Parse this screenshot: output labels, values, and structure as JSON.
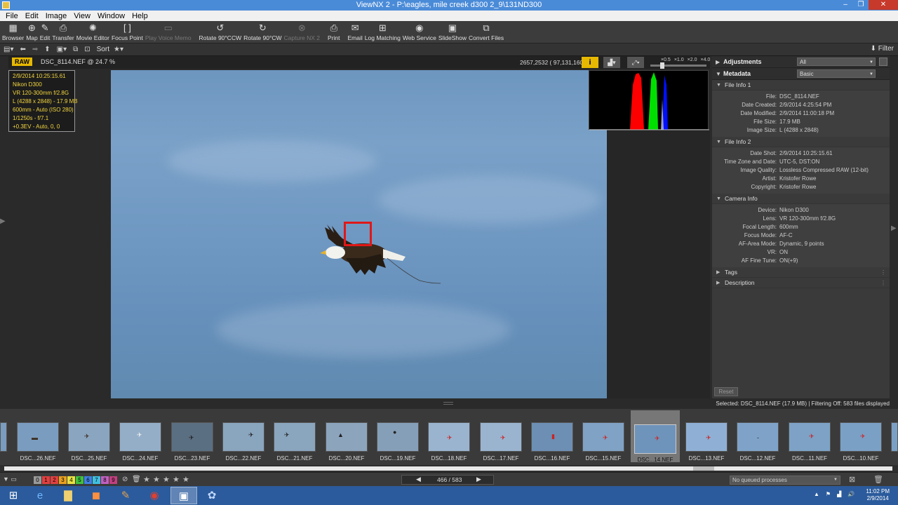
{
  "window": {
    "title": "ViewNX 2 - P:\\eagles, mile creek d300 2_9\\131ND300"
  },
  "menu": [
    "File",
    "Edit",
    "Image",
    "View",
    "Window",
    "Help"
  ],
  "toolbar": {
    "items": [
      {
        "label": "Browser",
        "icon": "browser-icon",
        "glyph": "▦",
        "enabled": true
      },
      {
        "label": "Map",
        "icon": "map-icon",
        "glyph": "⊕",
        "enabled": true
      },
      {
        "label": "Edit",
        "icon": "edit-icon",
        "glyph": "✎",
        "enabled": true
      },
      {
        "label": "Transfer",
        "icon": "transfer-icon",
        "glyph": "⎙",
        "enabled": true
      },
      {
        "label": "Movie Editor",
        "icon": "movie-editor-icon",
        "glyph": "✺",
        "enabled": true
      },
      {
        "label": "Focus Point",
        "icon": "focus-point-icon",
        "glyph": "[ ]",
        "enabled": true
      },
      {
        "label": "Play Voice Memo",
        "icon": "voice-memo-icon",
        "glyph": "▭",
        "enabled": false
      },
      {
        "label": "Rotate 90°CCW",
        "icon": "rotate-ccw-icon",
        "glyph": "↺",
        "enabled": true
      },
      {
        "label": "Rotate 90°CW",
        "icon": "rotate-cw-icon",
        "glyph": "↻",
        "enabled": true
      },
      {
        "label": "Capture NX 2",
        "icon": "capture-nx-icon",
        "glyph": "⊗",
        "enabled": false
      },
      {
        "label": "Print",
        "icon": "print-icon",
        "glyph": "⎙",
        "enabled": true
      },
      {
        "label": "Email",
        "icon": "email-icon",
        "glyph": "✉",
        "enabled": true
      },
      {
        "label": "Log Matching",
        "icon": "log-matching-icon",
        "glyph": "⊞",
        "enabled": true
      },
      {
        "label": "Web Service",
        "icon": "web-service-icon",
        "glyph": "◉",
        "enabled": true
      },
      {
        "label": "SlideShow",
        "icon": "slideshow-icon",
        "glyph": "▣",
        "enabled": true
      },
      {
        "label": "Convert Files",
        "icon": "convert-files-icon",
        "glyph": "⧉",
        "enabled": true
      }
    ]
  },
  "toolbar2": {
    "sort_label": "Sort",
    "filter_label": "Filter"
  },
  "viewer": {
    "format_badge": "RAW",
    "file_zoom": "DSC_8114.NEF @ 24.7 %",
    "coords": "2657,2532 (  97,131,160 )",
    "zoom_scale": [
      "×0.5",
      "×1.0",
      "×2.0",
      "×4.0"
    ],
    "info_lines": [
      "2/9/2014 10:25:15.61",
      "Nikon D300",
      "VR 120-300mm f/2.8G",
      "L (4288 x 2848) - 17.9 MB",
      "600mm - Auto (ISO 280)",
      "1/1250s - f/7.1",
      "+0.3EV - Auto, 0, 0"
    ]
  },
  "right_panel": {
    "adjustments": {
      "title": "Adjustments",
      "value": "All"
    },
    "metadata": {
      "title": "Metadata",
      "value": "Basic"
    },
    "file_info_1": {
      "title": "File Info 1",
      "rows": [
        {
          "k": "File:",
          "v": "DSC_8114.NEF"
        },
        {
          "k": "Date Created:",
          "v": "2/9/2014 4:25:54 PM"
        },
        {
          "k": "Date Modified:",
          "v": "2/9/2014 11:00:18 PM"
        },
        {
          "k": "File Size:",
          "v": "17.9 MB"
        },
        {
          "k": "Image Size:",
          "v": "L (4288 x 2848)"
        }
      ]
    },
    "file_info_2": {
      "title": "File Info 2",
      "rows": [
        {
          "k": "Date Shot:",
          "v": "2/9/2014 10:25:15.61"
        },
        {
          "k": "Time Zone and Date:",
          "v": "UTC-5, DST:ON"
        },
        {
          "k": "Image Quality:",
          "v": "Lossless Compressed RAW (12-bit)"
        },
        {
          "k": "Artist:",
          "v": "Kristofer Rowe"
        },
        {
          "k": "Copyright:",
          "v": "Kristofer Rowe"
        }
      ]
    },
    "camera_info": {
      "title": "Camera Info",
      "rows": [
        {
          "k": "Device:",
          "v": "Nikon D300"
        },
        {
          "k": "Lens:",
          "v": "VR 120-300mm f/2.8G"
        },
        {
          "k": "Focal Length:",
          "v": "600mm"
        },
        {
          "k": "Focus Mode:",
          "v": "AF-C"
        },
        {
          "k": "AF-Area Mode:",
          "v": "Dynamic, 9 points"
        },
        {
          "k": "VR:",
          "v": "ON"
        },
        {
          "k": "AF Fine Tune:",
          "v": "ON(+9)"
        }
      ]
    },
    "tags": "Tags",
    "description": "Description",
    "reset": "Reset"
  },
  "status": {
    "selected_text": "Selected: DSC_8114.NEF (17.9 MB) | Filtering Off: 583 files displayed"
  },
  "filmstrip": [
    {
      "cap": "DSC...26.NEF",
      "bg": "#7a9cbe"
    },
    {
      "cap": "DSC...25.NEF",
      "bg": "#8aa5c0"
    },
    {
      "cap": "DSC...24.NEF",
      "bg": "#94aec8"
    },
    {
      "cap": "DSC...23.NEF",
      "bg": "#5b6f82"
    },
    {
      "cap": "DSC...22.NEF",
      "bg": "#8aa5be"
    },
    {
      "cap": "DSC...21.NEF",
      "bg": "#8aa5be"
    },
    {
      "cap": "DSC...20.NEF",
      "bg": "#8ca4bc"
    },
    {
      "cap": "DSC...19.NEF",
      "bg": "#869fb8"
    },
    {
      "cap": "DSC...18.NEF",
      "bg": "#9ab4d0"
    },
    {
      "cap": "DSC...17.NEF",
      "bg": "#9ab4d0"
    },
    {
      "cap": "DSC...16.NEF",
      "bg": "#6d8fb4"
    },
    {
      "cap": "DSC...15.NEF",
      "bg": "#80a2c4"
    },
    {
      "cap": "DSC...14.NEF",
      "bg": "#6f94bb"
    },
    {
      "cap": "DSC...13.NEF",
      "bg": "#8fb0d4"
    },
    {
      "cap": "DSC...12.NEF",
      "bg": "#7fa3c8"
    },
    {
      "cap": "DSC...11.NEF",
      "bg": "#7da2c6"
    },
    {
      "cap": "DSC...10.NEF",
      "bg": "#7ba0c5"
    }
  ],
  "bottom": {
    "labels": [
      "0",
      "1",
      "2",
      "3",
      "4",
      "5",
      "6",
      "7",
      "8",
      "9"
    ],
    "label_colors": [
      "#999",
      "#e04040",
      "#e04040",
      "#e8a020",
      "#e8e040",
      "#40c040",
      "#4080e0",
      "#40c0e0",
      "#c060c0",
      "#c04080"
    ],
    "rating_stars": 0,
    "pager_count": "466 / 583",
    "queue": "No queued processes"
  },
  "taskbar": {
    "time": "11:02 PM",
    "date": "2/9/2014"
  }
}
